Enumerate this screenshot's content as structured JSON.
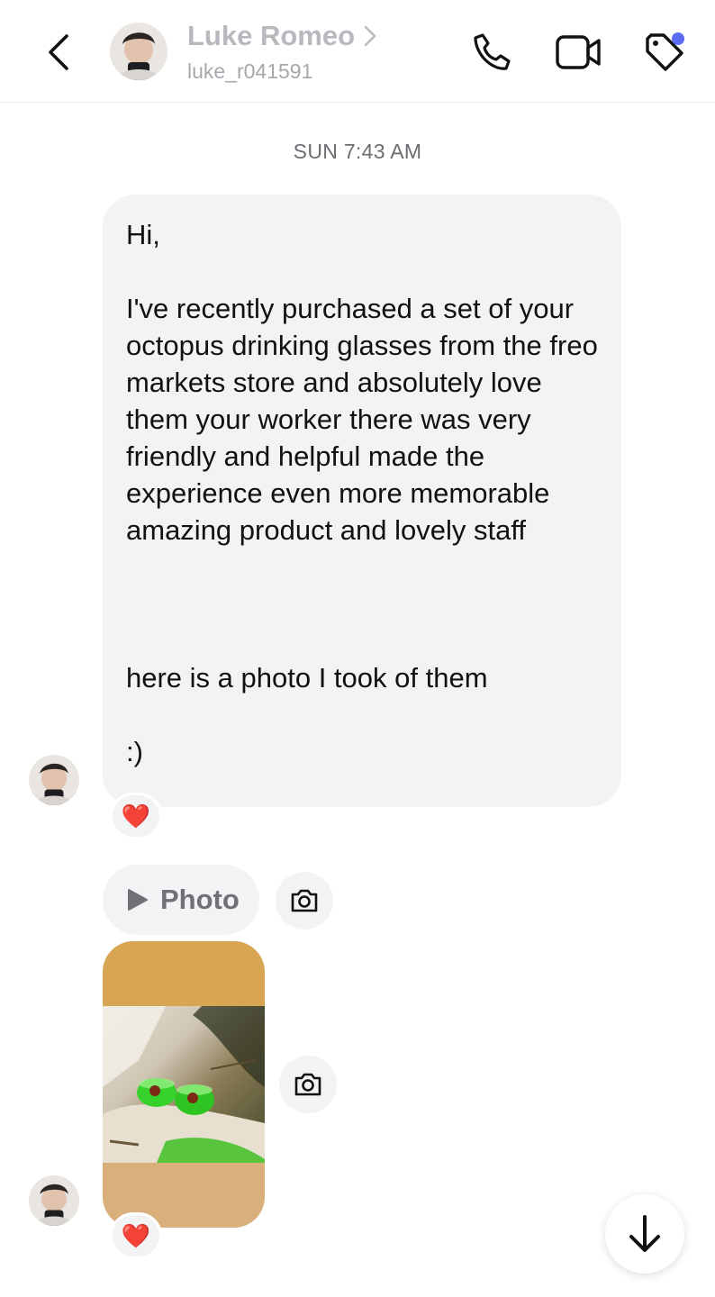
{
  "header": {
    "contact_name": "Luke Romeo",
    "contact_handle": "luke_r041591",
    "chevron": ">",
    "icons": [
      "back-icon",
      "phone-icon",
      "video-icon",
      "tag-icon"
    ],
    "notification_dot_color": "#5b6cf0"
  },
  "thread": {
    "timestamp": "SUN 7:43 AM",
    "message_text": "Hi,\n\nI've recently purchased a set of your octopus drinking glasses from the freo markets store and absolutely love them your worker there was very friendly and helpful made the experience even more memorable amazing product and lovely staff\n\n\n\nhere is a photo I took of them\n\n:)",
    "reaction_1": "❤️",
    "photo_label": "Photo",
    "reaction_2": "❤️"
  },
  "colors": {
    "bubble_bg": "#f2f3f5",
    "muted_text": "#b7b9bf",
    "photo_frame_top": "#d8a552",
    "photo_frame_bottom": "#d9b07b"
  }
}
